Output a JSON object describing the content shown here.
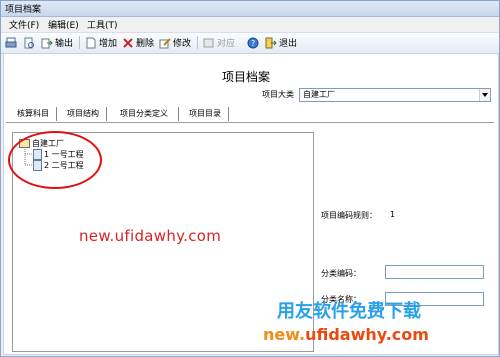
{
  "window": {
    "title": "项目档案"
  },
  "menu": {
    "file": "文件(F)",
    "edit": "编辑(E)",
    "tools": "工具(T)"
  },
  "toolbar": {
    "export": "输出",
    "add": "增加",
    "delete": "删除",
    "modify": "修改",
    "check": "对应",
    "exit": "退出"
  },
  "main": {
    "heading": "项目档案",
    "category_label": "项目大类",
    "category_value": "自建工厂",
    "tabs": [
      "核算科目",
      "项目结构",
      "项目分类定义",
      "项目目录"
    ],
    "tree": {
      "root": "自建工厂",
      "children": [
        "1 一号工程",
        "2 二号工程"
      ]
    },
    "code_rule_label": "项目编码规则：",
    "code_rule_value": "1",
    "class_code_label": "分类编码：",
    "class_name_label": "分类名称："
  },
  "watermark": {
    "url1": "new.ufidawhy.com",
    "cn": "用友软件免费下载",
    "url2_a": "new.",
    "url2_b": "ufidawhy.com"
  },
  "colors": {
    "annotation_circle": "#e01010",
    "watermark_red": "#d42424",
    "watermark_blue": "#2aa0e8"
  }
}
